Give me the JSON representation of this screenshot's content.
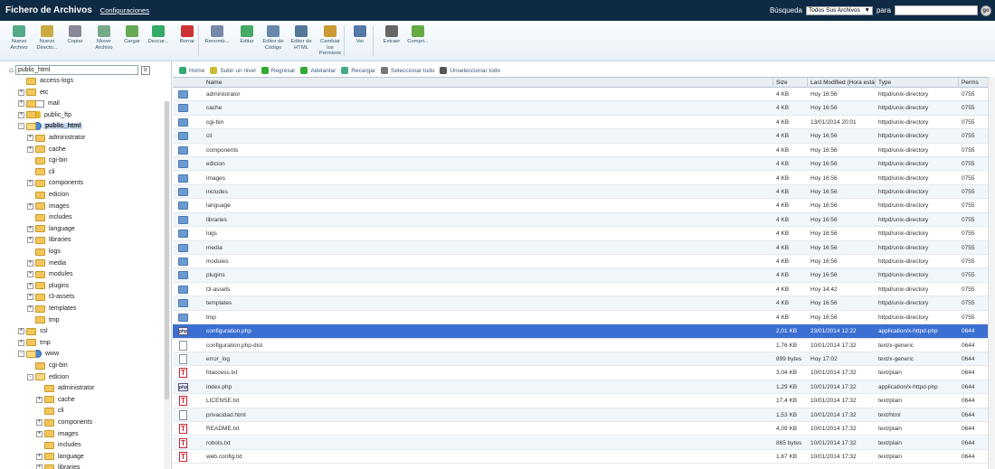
{
  "topbar": {
    "title": "Fichero de Archivos",
    "settings_link": "Configuraciones",
    "search_label": "Búsqueda",
    "search_scope": "Todos Sus Archivos",
    "for_label": "para",
    "search_value": ""
  },
  "toolbar": {
    "buttons": [
      {
        "label": "Nuevo Archivo",
        "icon": "new-file-icon"
      },
      {
        "label": "Nuevo Directo...",
        "icon": "new-folder-icon"
      },
      {
        "label": "Copiar",
        "icon": "copy-icon"
      },
      {
        "label": "Mover Archivo",
        "icon": "move-icon"
      },
      {
        "label": "Cargar",
        "icon": "upload-icon"
      },
      {
        "label": "Descar...",
        "icon": "download-icon"
      },
      {
        "label": "Borrar",
        "icon": "delete-icon"
      },
      {
        "label": "Renomb...",
        "icon": "rename-icon"
      },
      {
        "label": "Editar",
        "icon": "edit-icon"
      },
      {
        "label": "Editor de Código",
        "icon": "code-editor-icon"
      },
      {
        "label": "Editor de HTML",
        "icon": "html-editor-icon"
      },
      {
        "label": "Cambiar los Permisos",
        "icon": "permissions-icon"
      },
      {
        "label": "Ver",
        "icon": "view-icon"
      },
      {
        "label": "Extraer",
        "icon": "extract-icon"
      },
      {
        "label": "Compri...",
        "icon": "compress-icon"
      }
    ]
  },
  "tree": {
    "path_value": "public_html",
    "nodes": [
      {
        "label": "access-logs",
        "level": 1,
        "expand": "",
        "kind": "folder"
      },
      {
        "label": "etc",
        "level": 1,
        "expand": "+",
        "kind": "folder"
      },
      {
        "label": "mail",
        "level": 1,
        "expand": "+",
        "kind": "mail"
      },
      {
        "label": "public_ftp",
        "level": 1,
        "expand": "+",
        "kind": "lock"
      },
      {
        "label": "public_html",
        "level": 1,
        "expand": "-",
        "kind": "globe",
        "selected": true
      },
      {
        "label": "administrator",
        "level": 2,
        "expand": "+",
        "kind": "folder"
      },
      {
        "label": "cache",
        "level": 2,
        "expand": "+",
        "kind": "folder"
      },
      {
        "label": "cgi-bin",
        "level": 2,
        "expand": "",
        "kind": "folder"
      },
      {
        "label": "cli",
        "level": 2,
        "expand": "",
        "kind": "folder"
      },
      {
        "label": "components",
        "level": 2,
        "expand": "+",
        "kind": "folder"
      },
      {
        "label": "edicion",
        "level": 2,
        "expand": "",
        "kind": "folder"
      },
      {
        "label": "images",
        "level": 2,
        "expand": "+",
        "kind": "folder"
      },
      {
        "label": "includes",
        "level": 2,
        "expand": "",
        "kind": "folder"
      },
      {
        "label": "language",
        "level": 2,
        "expand": "+",
        "kind": "folder"
      },
      {
        "label": "libraries",
        "level": 2,
        "expand": "+",
        "kind": "folder"
      },
      {
        "label": "logs",
        "level": 2,
        "expand": "",
        "kind": "folder"
      },
      {
        "label": "media",
        "level": 2,
        "expand": "+",
        "kind": "folder"
      },
      {
        "label": "modules",
        "level": 2,
        "expand": "+",
        "kind": "folder"
      },
      {
        "label": "plugins",
        "level": 2,
        "expand": "+",
        "kind": "folder"
      },
      {
        "label": "t3-assets",
        "level": 2,
        "expand": "+",
        "kind": "folder"
      },
      {
        "label": "templates",
        "level": 2,
        "expand": "+",
        "kind": "folder"
      },
      {
        "label": "tmp",
        "level": 2,
        "expand": "",
        "kind": "folder"
      },
      {
        "label": "ssl",
        "level": 1,
        "expand": "+",
        "kind": "folder"
      },
      {
        "label": "tmp",
        "level": 1,
        "expand": "+",
        "kind": "folder"
      },
      {
        "label": "www",
        "level": 1,
        "expand": "-",
        "kind": "globe"
      },
      {
        "label": "cgi-bin",
        "level": 2,
        "expand": "",
        "kind": "folder"
      },
      {
        "label": "edicion",
        "level": 2,
        "expand": "-",
        "kind": "folder-open"
      },
      {
        "label": "administrator",
        "level": 3,
        "expand": "",
        "kind": "folder"
      },
      {
        "label": "cache",
        "level": 3,
        "expand": "+",
        "kind": "folder"
      },
      {
        "label": "cli",
        "level": 3,
        "expand": "",
        "kind": "folder"
      },
      {
        "label": "components",
        "level": 3,
        "expand": "+",
        "kind": "folder"
      },
      {
        "label": "images",
        "level": 3,
        "expand": "+",
        "kind": "folder"
      },
      {
        "label": "includes",
        "level": 3,
        "expand": "",
        "kind": "folder"
      },
      {
        "label": "language",
        "level": 3,
        "expand": "+",
        "kind": "folder"
      },
      {
        "label": "libraries",
        "level": 3,
        "expand": "+",
        "kind": "folder"
      }
    ]
  },
  "navbar": {
    "items": [
      {
        "label": "Home",
        "icon": "home-icon"
      },
      {
        "label": "Subir un nivel",
        "icon": "up-level-icon"
      },
      {
        "label": "Regresar",
        "icon": "back-icon"
      },
      {
        "label": "Adelantar",
        "icon": "forward-icon"
      },
      {
        "label": "Recargar",
        "icon": "reload-icon"
      },
      {
        "label": "Seleccionar todo",
        "icon": "select-all-icon"
      },
      {
        "label": "Unseleccionar todo",
        "icon": "unselect-all-icon"
      }
    ]
  },
  "table": {
    "headers": {
      "name": "Name",
      "size": "Size",
      "modified": "Last Modified (Hora está",
      "type": "Type",
      "perms": "Perms"
    },
    "rows": [
      {
        "name": "administrator",
        "size": "4 KB",
        "modified": "Hoy 16:56",
        "type": "httpd/unix-directory",
        "perms": "0755",
        "icon": "folder"
      },
      {
        "name": "cache",
        "size": "4 KB",
        "modified": "Hoy 16:56",
        "type": "httpd/unix-directory",
        "perms": "0755",
        "icon": "folder"
      },
      {
        "name": "cgi-bin",
        "size": "4 KB",
        "modified": "13/01/2014 20:01",
        "type": "httpd/unix-directory",
        "perms": "0755",
        "icon": "folder"
      },
      {
        "name": "cli",
        "size": "4 KB",
        "modified": "Hoy 16:56",
        "type": "httpd/unix-directory",
        "perms": "0755",
        "icon": "folder"
      },
      {
        "name": "components",
        "size": "4 KB",
        "modified": "Hoy 16:56",
        "type": "httpd/unix-directory",
        "perms": "0755",
        "icon": "folder"
      },
      {
        "name": "edicion",
        "size": "4 KB",
        "modified": "Hoy 16:56",
        "type": "httpd/unix-directory",
        "perms": "0755",
        "icon": "folder"
      },
      {
        "name": "images",
        "size": "4 KB",
        "modified": "Hoy 16:56",
        "type": "httpd/unix-directory",
        "perms": "0755",
        "icon": "folder"
      },
      {
        "name": "includes",
        "size": "4 KB",
        "modified": "Hoy 16:56",
        "type": "httpd/unix-directory",
        "perms": "0755",
        "icon": "folder"
      },
      {
        "name": "language",
        "size": "4 KB",
        "modified": "Hoy 16:56",
        "type": "httpd/unix-directory",
        "perms": "0755",
        "icon": "folder"
      },
      {
        "name": "libraries",
        "size": "4 KB",
        "modified": "Hoy 16:56",
        "type": "httpd/unix-directory",
        "perms": "0755",
        "icon": "folder"
      },
      {
        "name": "logs",
        "size": "4 KB",
        "modified": "Hoy 16:56",
        "type": "httpd/unix-directory",
        "perms": "0755",
        "icon": "folder"
      },
      {
        "name": "media",
        "size": "4 KB",
        "modified": "Hoy 16:56",
        "type": "httpd/unix-directory",
        "perms": "0755",
        "icon": "folder"
      },
      {
        "name": "modules",
        "size": "4 KB",
        "modified": "Hoy 16:56",
        "type": "httpd/unix-directory",
        "perms": "0755",
        "icon": "folder"
      },
      {
        "name": "plugins",
        "size": "4 KB",
        "modified": "Hoy 16:56",
        "type": "httpd/unix-directory",
        "perms": "0755",
        "icon": "folder"
      },
      {
        "name": "t3-assets",
        "size": "4 KB",
        "modified": "Hoy 14:42",
        "type": "httpd/unix-directory",
        "perms": "0755",
        "icon": "folder"
      },
      {
        "name": "templates",
        "size": "4 KB",
        "modified": "Hoy 16:56",
        "type": "httpd/unix-directory",
        "perms": "0755",
        "icon": "folder"
      },
      {
        "name": "tmp",
        "size": "4 KB",
        "modified": "Hoy 16:56",
        "type": "httpd/unix-directory",
        "perms": "0755",
        "icon": "folder"
      },
      {
        "name": "configuration.php",
        "size": "2,01 KB",
        "modified": "23/01/2014 12:22",
        "type": "application/x-httpd-php",
        "perms": "0644",
        "icon": "php",
        "selected": true
      },
      {
        "name": "configuration.php-dist",
        "size": "1,76 KB",
        "modified": "10/01/2014 17:32",
        "type": "text/x-generic",
        "perms": "0644",
        "icon": "file"
      },
      {
        "name": "error_log",
        "size": "899 bytes",
        "modified": "Hoy 17:02",
        "type": "text/x-generic",
        "perms": "0644",
        "icon": "file"
      },
      {
        "name": "htaccess.txt",
        "size": "3,04 KB",
        "modified": "10/01/2014 17:32",
        "type": "text/plain",
        "perms": "0644",
        "icon": "txt"
      },
      {
        "name": "index.php",
        "size": "1,29 KB",
        "modified": "10/01/2014 17:32",
        "type": "application/x-httpd-php",
        "perms": "0644",
        "icon": "php"
      },
      {
        "name": "LICENSE.txt",
        "size": "17,4 KB",
        "modified": "10/01/2014 17:32",
        "type": "text/plain",
        "perms": "0644",
        "icon": "txt"
      },
      {
        "name": "privacidad.html",
        "size": "1,53 KB",
        "modified": "10/01/2014 17:32",
        "type": "text/html",
        "perms": "0644",
        "icon": "html"
      },
      {
        "name": "README.txt",
        "size": "4,09 KB",
        "modified": "10/01/2014 17:32",
        "type": "text/plain",
        "perms": "0644",
        "icon": "txt"
      },
      {
        "name": "robots.txt",
        "size": "865 bytes",
        "modified": "10/01/2014 17:32",
        "type": "text/plain",
        "perms": "0644",
        "icon": "txt"
      },
      {
        "name": "web.config.txt",
        "size": "1,67 KB",
        "modified": "10/01/2014 17:32",
        "type": "text/plain",
        "perms": "0644",
        "icon": "txt"
      }
    ]
  },
  "colors": {
    "topbar": "#0e2a45",
    "selected_row": "#3b6fd1",
    "alt_row": "#f1f6fb"
  }
}
